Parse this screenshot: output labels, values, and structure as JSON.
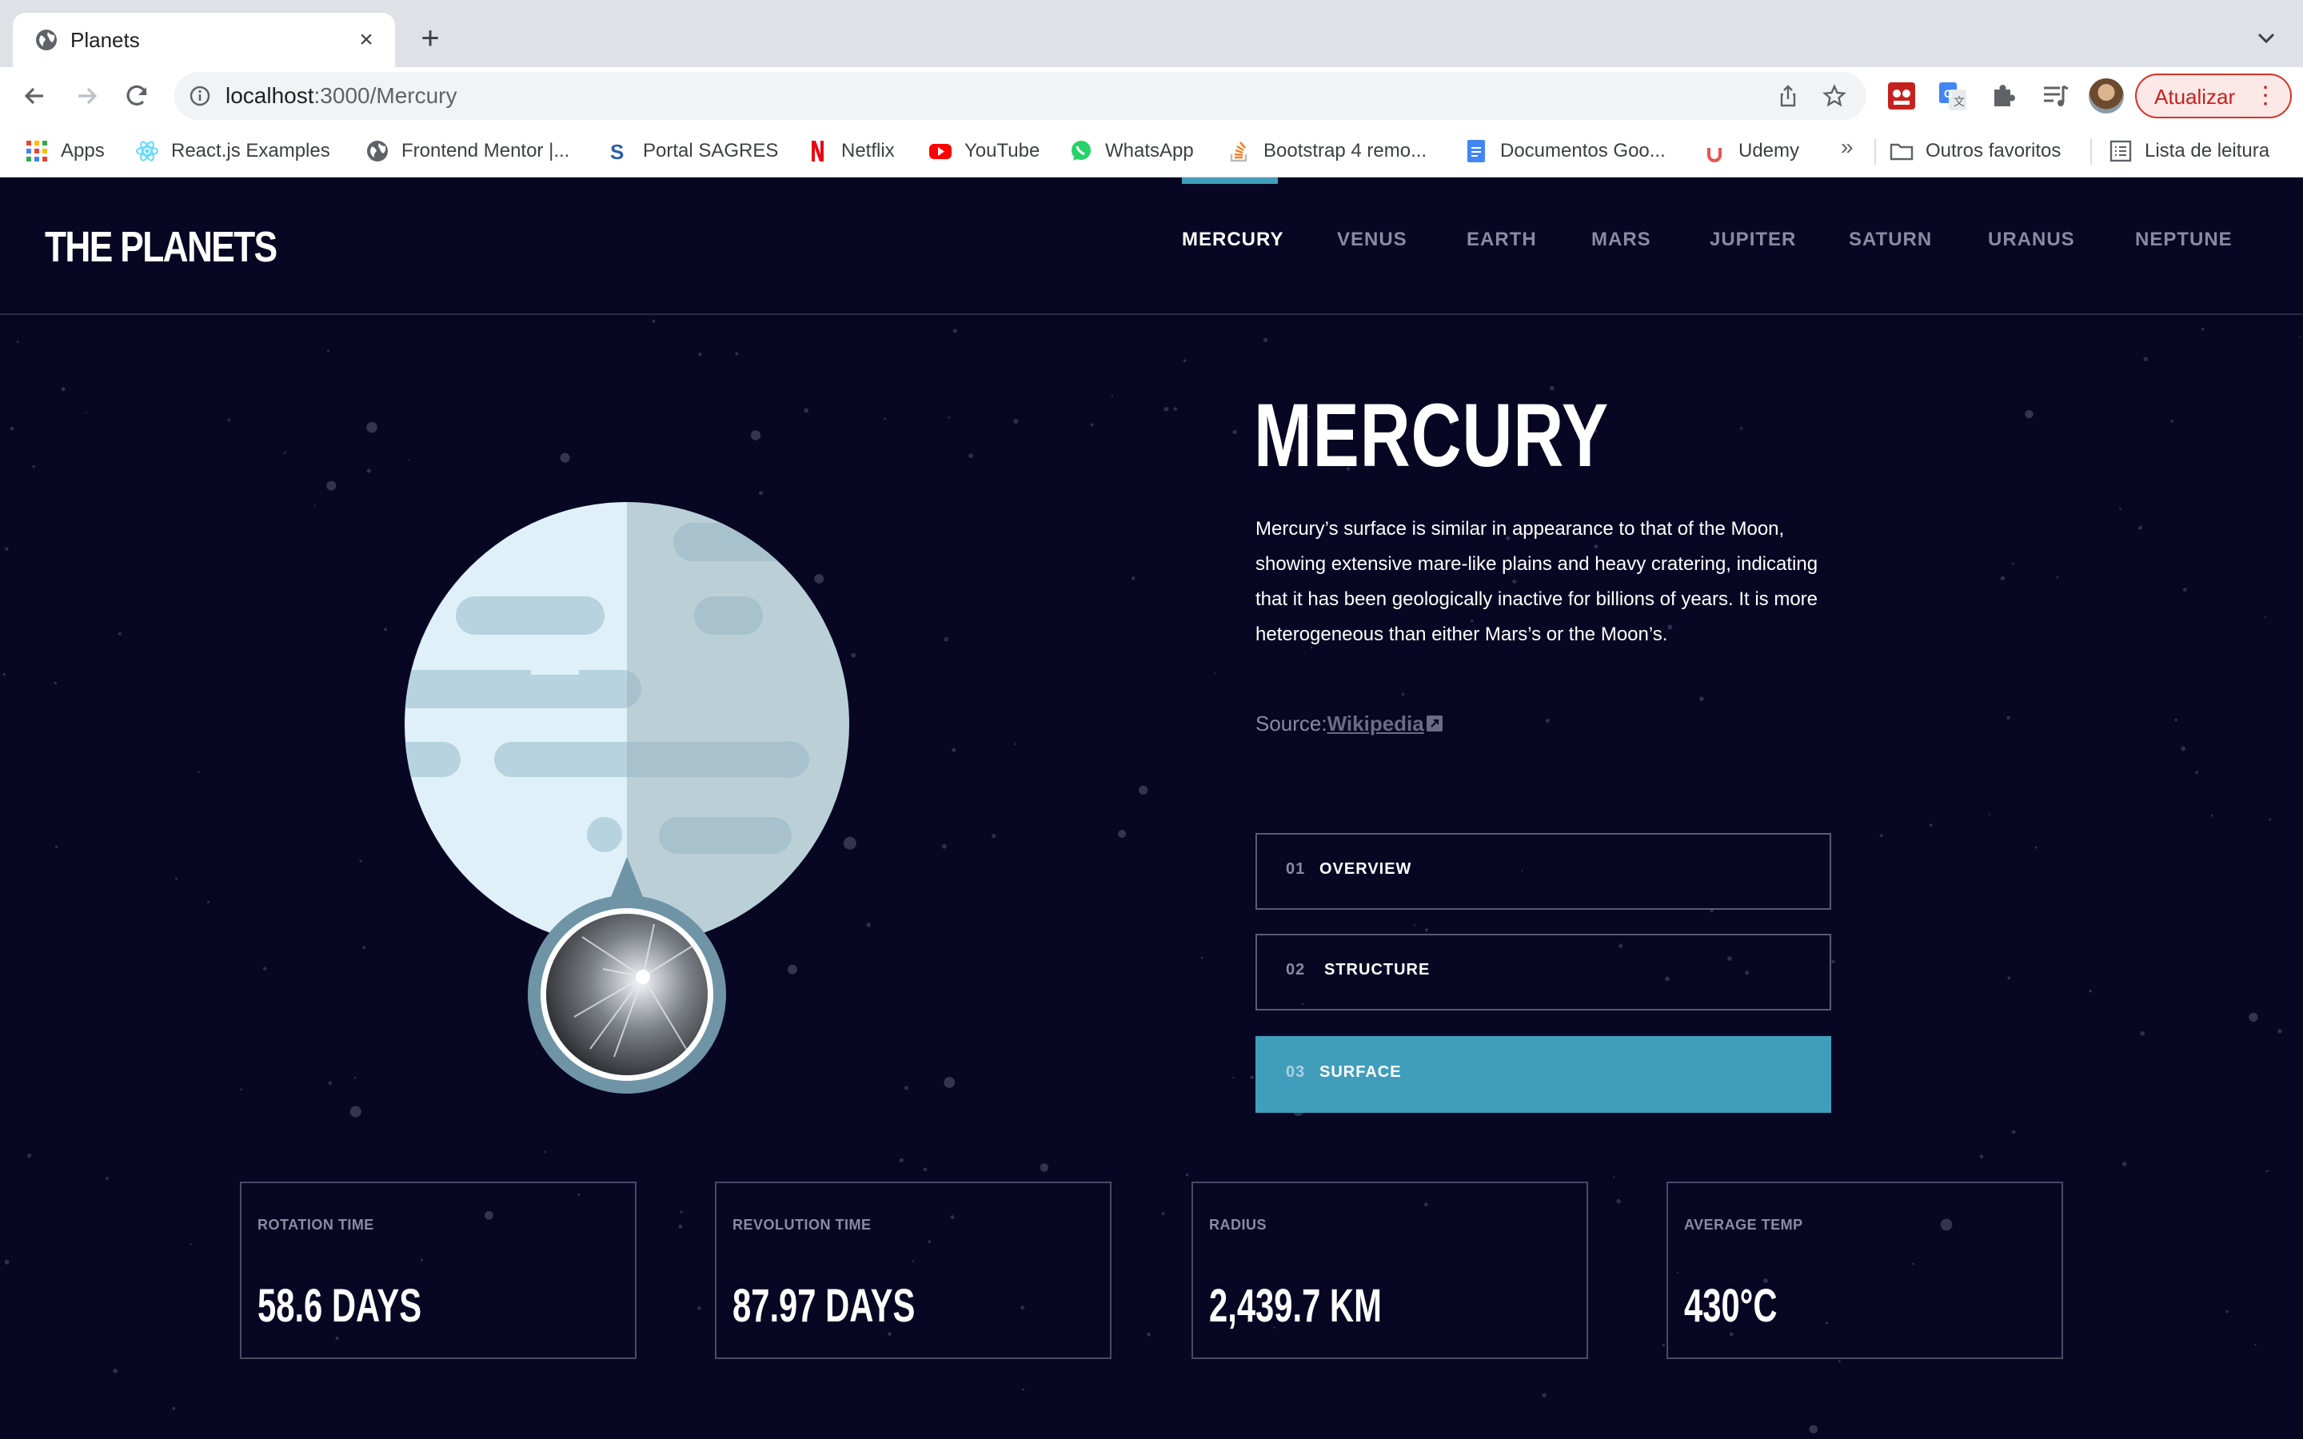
{
  "browser": {
    "tab_title": "Planets",
    "url_host": "localhost",
    "url_path": ":3000/Mercury",
    "update_label": "Atualizar",
    "bookmarks": [
      {
        "label": "Apps",
        "icon": "apps-grid-icon"
      },
      {
        "label": "React.js Examples",
        "icon": "react-icon"
      },
      {
        "label": "Frontend Mentor |...",
        "icon": "globe-icon"
      },
      {
        "label": "Portal SAGRES",
        "icon": "sagres-icon"
      },
      {
        "label": "Netflix",
        "icon": "netflix-icon"
      },
      {
        "label": "YouTube",
        "icon": "youtube-icon"
      },
      {
        "label": "WhatsApp",
        "icon": "whatsapp-icon"
      },
      {
        "label": "Bootstrap 4 remo...",
        "icon": "stackoverflow-icon"
      },
      {
        "label": "Documentos Goo...",
        "icon": "google-docs-icon"
      },
      {
        "label": "Udemy",
        "icon": "udemy-icon"
      }
    ],
    "more_bookmarks": "»",
    "other_bookmarks": "Outros favoritos",
    "reading_list": "Lista de leitura"
  },
  "site": {
    "logo": "THE PLANETS",
    "nav": [
      "MERCURY",
      "VENUS",
      "EARTH",
      "MARS",
      "JUPITER",
      "SATURN",
      "URANUS",
      "NEPTUNE"
    ],
    "active_nav": "MERCURY",
    "accent_color": "#419ebb",
    "background_color": "#070724"
  },
  "planet": {
    "name": "MERCURY",
    "description": "Mercury’s surface is similar in appearance to that of the Moon, showing extensive mare-like plains and heavy cratering, indicating that it has been geologically inactive for billions of years. It is more heterogeneous than either Mars’s or the Moon’s.",
    "source_prefix": "Source:",
    "source_link": "Wikipedia",
    "modes": [
      {
        "num": "01",
        "label": "OVERVIEW",
        "active": false
      },
      {
        "num": "02",
        "label": "STRUCTURE",
        "active": false
      },
      {
        "num": "03",
        "label": "SURFACE",
        "active": true
      }
    ],
    "stats": [
      {
        "label": "ROTATION TIME",
        "value": "58.6 DAYS"
      },
      {
        "label": "REVOLUTION TIME",
        "value": "87.97 DAYS"
      },
      {
        "label": "RADIUS",
        "value": "2,439.7 KM"
      },
      {
        "label": "AVERAGE TEMP",
        "value": "430°C"
      }
    ]
  }
}
